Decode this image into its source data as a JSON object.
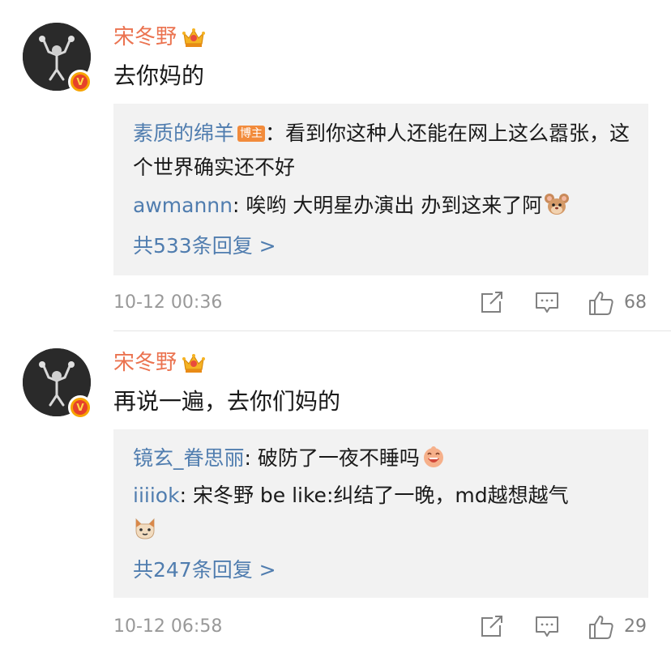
{
  "comments": [
    {
      "username": "宋冬野",
      "avatar_badge": "V",
      "text": "去你妈的",
      "replies": [
        {
          "user": "素质的绵羊",
          "tag": "博主",
          "sep": "：",
          "text": "看到你这种人还能在网上这么嚣张，这个世界确实还不好"
        },
        {
          "user": "awmannn",
          "sep": ": ",
          "text": "唉哟 大明星办演出 办到这来了阿"
        }
      ],
      "reply_count": "共533条回复 >",
      "timestamp": "10-12 00:36",
      "likes": "68"
    },
    {
      "username": "宋冬野",
      "avatar_badge": "V",
      "text": "再说一遍，去你们妈的",
      "replies": [
        {
          "user": "镜玄_眷思丽",
          "sep": ": ",
          "text": "破防了一夜不睡吗"
        },
        {
          "user": "iiiiok",
          "sep": ": ",
          "text": "宋冬野 be like:纠结了一晚，md越想越气"
        }
      ],
      "reply_count": "共247条回复 >",
      "timestamp": "10-12 06:58",
      "likes": "29"
    }
  ],
  "colors": {
    "username": "#eb7350",
    "reply_user": "#507daf",
    "reply_bg": "#f2f2f2",
    "meta": "#999999"
  }
}
